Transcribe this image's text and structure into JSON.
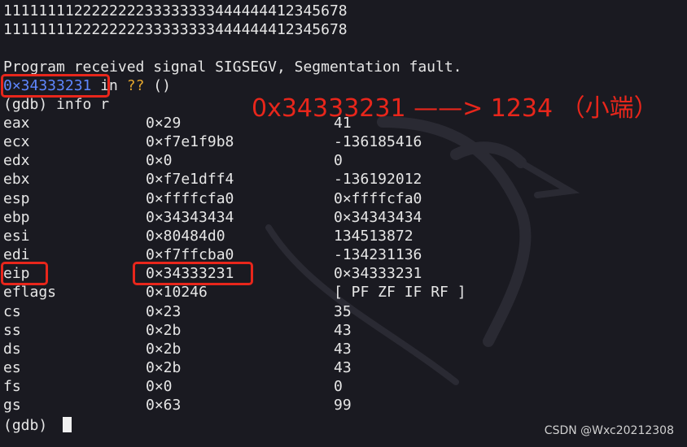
{
  "terminal": {
    "output_lines": [
      "111111112222222233333333444444412345678",
      "111111112222222233333333444444412345678"
    ],
    "signal_line": "Program received signal SIGSEGV, Segmentation fault.",
    "frame": {
      "address": "0×34333231",
      "in_text": " in ",
      "func": "??",
      "args": " ()"
    },
    "command": "(gdb) info r",
    "registers": [
      {
        "name": "eax",
        "hex": "0×29",
        "value": "41"
      },
      {
        "name": "ecx",
        "hex": "0×f7e1f9b8",
        "value": "-136185416"
      },
      {
        "name": "edx",
        "hex": "0×0",
        "value": "0"
      },
      {
        "name": "ebx",
        "hex": "0×f7e1dff4",
        "value": "-136192012"
      },
      {
        "name": "esp",
        "hex": "0×ffffcfa0",
        "value": "0×ffffcfa0"
      },
      {
        "name": "ebp",
        "hex": "0×34343434",
        "value": "0×34343434"
      },
      {
        "name": "esi",
        "hex": "0×80484d0",
        "value": "134513872"
      },
      {
        "name": "edi",
        "hex": "0×f7ffcba0",
        "value": "-134231136"
      },
      {
        "name": "eip",
        "hex": "0×34333231",
        "value": "0×34333231"
      },
      {
        "name": "eflags",
        "hex": "0×10246",
        "value": "[ PF ZF IF RF ]"
      },
      {
        "name": "cs",
        "hex": "0×23",
        "value": "35"
      },
      {
        "name": "ss",
        "hex": "0×2b",
        "value": "43"
      },
      {
        "name": "ds",
        "hex": "0×2b",
        "value": "43"
      },
      {
        "name": "es",
        "hex": "0×2b",
        "value": "43"
      },
      {
        "name": "fs",
        "hex": "0×0",
        "value": "0"
      },
      {
        "name": "gs",
        "hex": "0×63",
        "value": "99"
      }
    ],
    "prompt": "(gdb) "
  },
  "annotation": "0x34333231 ——> 1234 （小端）",
  "watermark": "CSDN @Wxc20212308",
  "colors": {
    "background": "#1a1a21",
    "text": "#e6e6e6",
    "address": "#5f87ff",
    "question": "#e5a72d",
    "highlight": "#e8261b"
  }
}
